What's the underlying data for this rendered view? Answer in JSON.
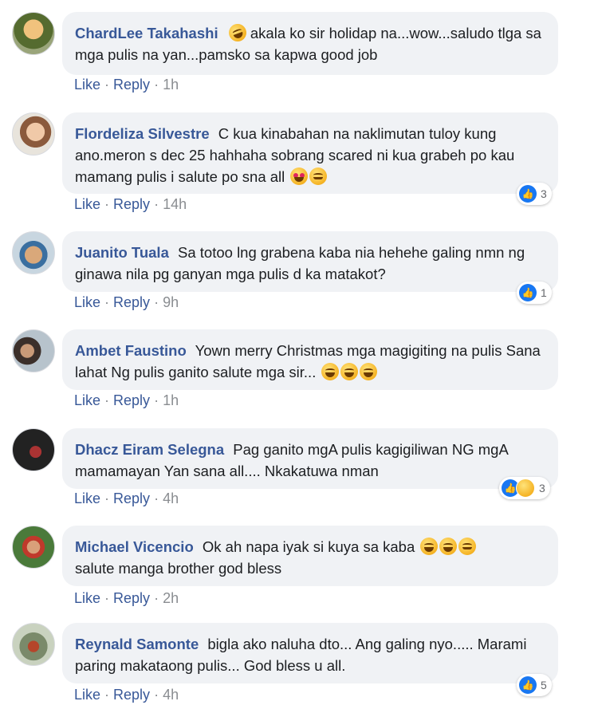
{
  "comments": [
    {
      "author": "ChardLee Takahashi",
      "text": "akala ko sir holidap na...wow...saludo tlga sa mga pulis na yan...pamsko sa kapwa good job",
      "like": "Like",
      "reply": "Reply",
      "time": "1h",
      "reactions": null
    },
    {
      "author": "Flordeliza Silvestre",
      "text": "C kua kinabahan na naklimutan tuloy kung ano.meron s dec 25 hahhaha sobrang scared ni kua grabeh po kau mamang pulis i salute po sna all",
      "like": "Like",
      "reply": "Reply",
      "time": "14h",
      "reactions": "3"
    },
    {
      "author": "Juanito Tuala",
      "text": "Sa totoo lng grabena kaba nia hehehe galing nmn ng ginawa nila pg ganyan mga pulis d ka matakot?",
      "like": "Like",
      "reply": "Reply",
      "time": "9h",
      "reactions": "1"
    },
    {
      "author": "Ambet Faustino",
      "text": "Yown merry Christmas mga magigiting na pulis Sana lahat Ng pulis ganito salute mga sir...",
      "like": "Like",
      "reply": "Reply",
      "time": "1h",
      "reactions": null
    },
    {
      "author": "Dhacz Eiram Selegna",
      "text": "Pag ganito mgA pulis kagigiliwan NG mgA mamamayan Yan sana all.... Nkakatuwa nman",
      "like": "Like",
      "reply": "Reply",
      "time": "4h",
      "reactions": "3"
    },
    {
      "author": "Michael Vicencio",
      "text": "Ok ah napa iyak si kuya sa kaba",
      "text2": "salute manga brother god bless",
      "like": "Like",
      "reply": "Reply",
      "time": "2h",
      "reactions": null
    },
    {
      "author": "Reynald Samonte",
      "text": "bigla ako naluha dto... Ang galing nyo..... Marami paring makataong pulis... God bless u all.",
      "like": "Like",
      "reply": "Reply",
      "time": "4h",
      "reactions": "5"
    }
  ],
  "colors": {
    "author": "#385898",
    "bubble": "#f0f2f5",
    "like_blue": "#1877f2",
    "meta": "#8a8d91"
  }
}
